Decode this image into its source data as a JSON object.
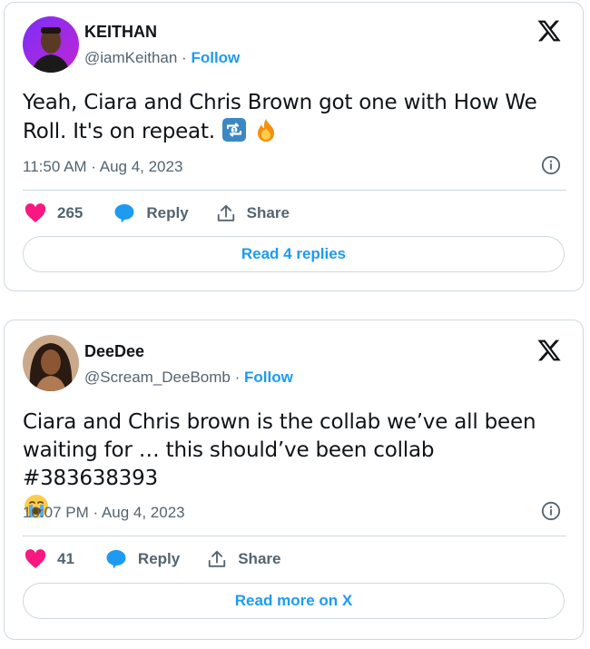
{
  "tweets": [
    {
      "display_name": "KEITHAN",
      "handle": "@iamKeithan",
      "separator": "·",
      "follow_label": "Follow",
      "text_line1": "Yeah, Ciara and Chris Brown got one with How We",
      "text_line2": "Roll. It's on repeat.",
      "emojis": [
        "repeat-one-emoji",
        "fire-emoji"
      ],
      "timestamp": "11:50 AM · Aug 4, 2023",
      "likes": "265",
      "reply_label": "Reply",
      "share_label": "Share",
      "cta_label": "Read 4 replies"
    },
    {
      "display_name": "DeeDee",
      "handle": "@Scream_DeeBomb",
      "separator": "·",
      "follow_label": "Follow",
      "text_line1": "Ciara and Chris brown is the collab we’ve all been",
      "text_line2": "waiting for … this should’ve been collab #383638393",
      "emojis": [
        "loudly-crying-face-emoji"
      ],
      "timestamp": "10:07 PM · Aug 4, 2023",
      "likes": "41",
      "reply_label": "Reply",
      "share_label": "Share",
      "cta_label": "Read more on X"
    }
  ],
  "colors": {
    "accent": "#1d9bf0",
    "like": "#f91880",
    "text": "#0f1419",
    "muted": "#536471",
    "border": "#cfd9de"
  },
  "icons": [
    "x-logo-icon",
    "info-icon",
    "heart-icon",
    "reply-bubble-icon",
    "share-icon"
  ]
}
